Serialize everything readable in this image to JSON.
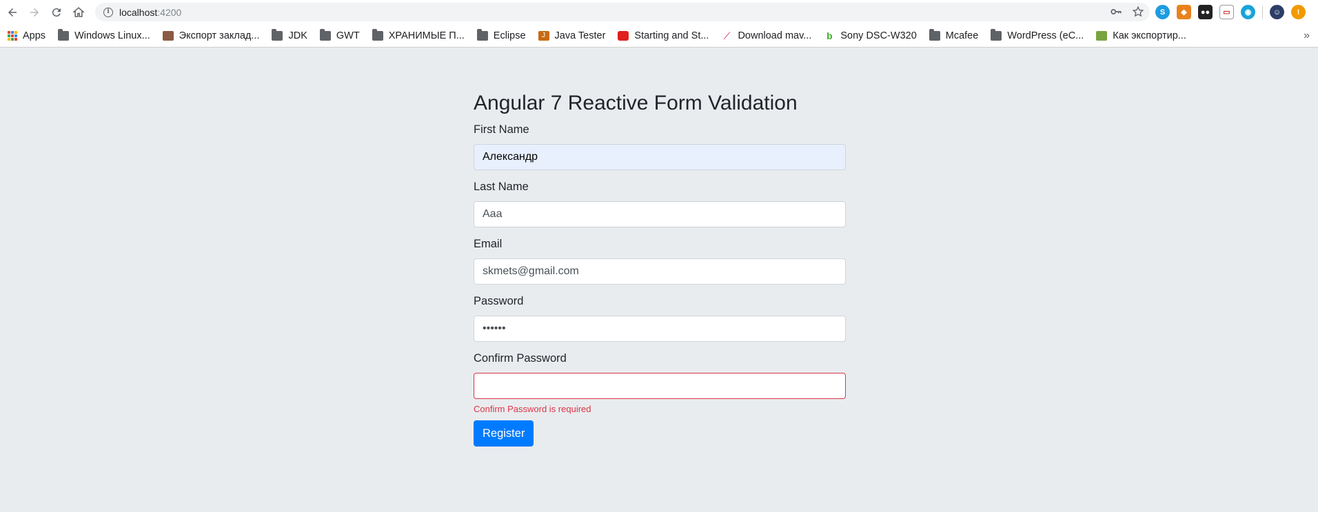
{
  "browser": {
    "url_host": "localhost",
    "url_port": ":4200",
    "bookmarks": [
      {
        "label": "Apps",
        "icon": "apps-grid-icon"
      },
      {
        "label": "Windows Linux...",
        "icon": "folder-icon"
      },
      {
        "label": "Экспорт заклад...",
        "icon": "bookmark-favicon-icon"
      },
      {
        "label": "JDK",
        "icon": "folder-icon"
      },
      {
        "label": "GWT",
        "icon": "folder-icon"
      },
      {
        "label": "ХРАНИМЫЕ П...",
        "icon": "folder-icon"
      },
      {
        "label": "Eclipse",
        "icon": "folder-icon"
      },
      {
        "label": "Java Tester",
        "icon": "java-icon"
      },
      {
        "label": "Starting and St...",
        "icon": "oracle-icon"
      },
      {
        "label": "Download mav...",
        "icon": "feather-icon"
      },
      {
        "label": "Sony DSC-W320",
        "icon": "green-b-icon"
      },
      {
        "label": "Mcafee",
        "icon": "folder-icon"
      },
      {
        "label": "WordPress (eC...",
        "icon": "folder-icon"
      },
      {
        "label": "Как экспортир...",
        "icon": "spreadsheet-icon"
      }
    ],
    "more_bookmarks": "»"
  },
  "page": {
    "title": "Angular 7 Reactive Form Validation",
    "fields": {
      "first_name": {
        "label": "First Name",
        "value": "Александр"
      },
      "last_name": {
        "label": "Last Name",
        "value": "Aaa"
      },
      "email": {
        "label": "Email",
        "value": "skmets@gmail.com"
      },
      "password": {
        "label": "Password",
        "value": "••••••"
      },
      "confirm_password": {
        "label": "Confirm Password",
        "value": "",
        "error": "Confirm Password is required"
      }
    },
    "register_label": "Register"
  },
  "colors": {
    "background": "#e9ecef",
    "primary": "#007bff",
    "danger": "#dc3545",
    "autofill": "#e8f0fe"
  }
}
